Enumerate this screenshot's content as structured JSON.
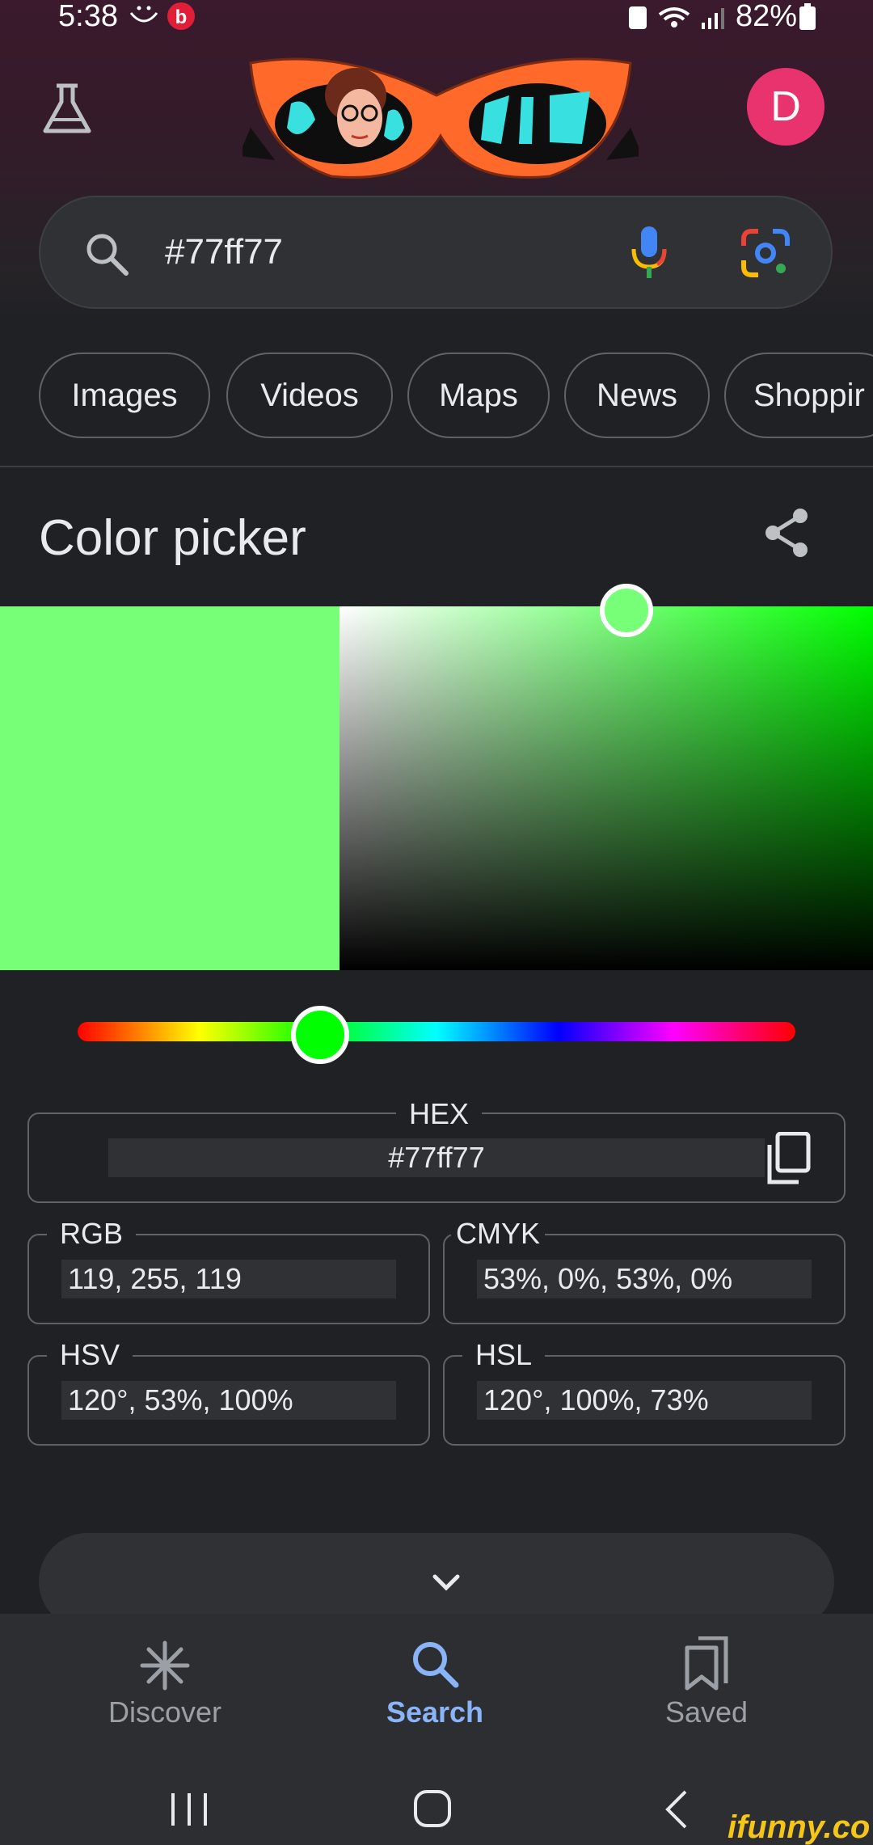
{
  "status_bar": {
    "time": "5:38",
    "battery": "82%"
  },
  "search": {
    "query": "#77ff77"
  },
  "avatar": {
    "initial": "D",
    "color": "#e8336f"
  },
  "chips": [
    "Images",
    "Videos",
    "Maps",
    "News",
    "Shoppir"
  ],
  "card": {
    "title": "Color picker",
    "selected_color": "#77ff77",
    "hue_color": "#00ff00"
  },
  "fields": {
    "hex": {
      "label": "HEX",
      "value": "#77ff77"
    },
    "rgb": {
      "label": "RGB",
      "value": "119, 255, 119"
    },
    "cmyk": {
      "label": "CMYK",
      "value": "53%, 0%, 53%, 0%"
    },
    "hsv": {
      "label": "HSV",
      "value": "120°, 53%, 100%"
    },
    "hsl": {
      "label": "HSL",
      "value": "120°, 100%, 73%"
    }
  },
  "bottom_nav": {
    "items": [
      {
        "label": "Discover",
        "icon": "asterisk-icon",
        "active": false
      },
      {
        "label": "Search",
        "icon": "search-icon",
        "active": true
      },
      {
        "label": "Saved",
        "icon": "bookmarks-icon",
        "active": false
      }
    ],
    "active_color": "#8ab4f8",
    "inactive_color": "#9aa0a6"
  },
  "watermark": "ifunny.co"
}
